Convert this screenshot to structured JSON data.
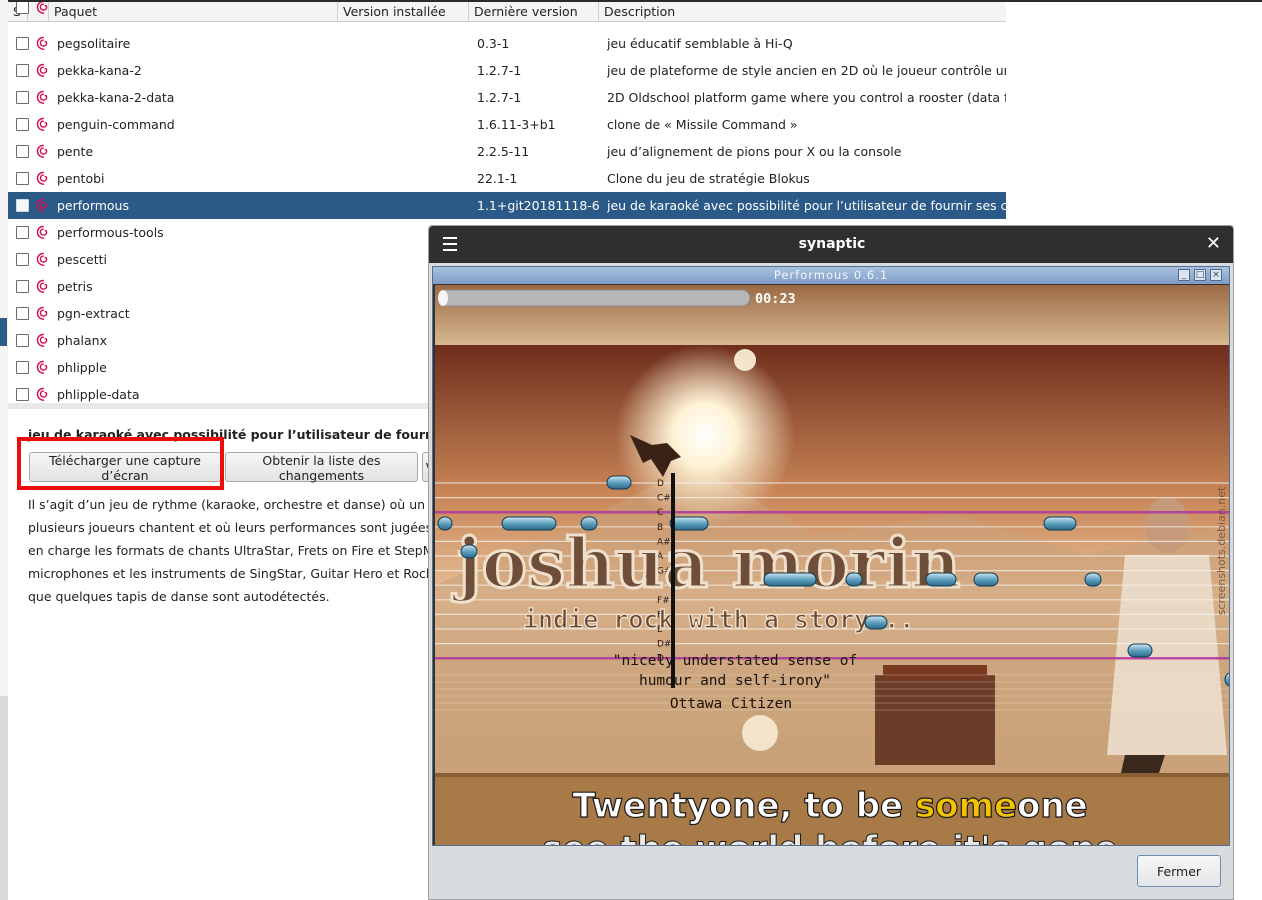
{
  "table": {
    "columns": [
      "S",
      "",
      "Paquet",
      "Version installée",
      "Dernière version",
      "Description"
    ],
    "rows": [
      {
        "name": "pegsolitaire",
        "version": "0.3-1",
        "description": "jeu éducatif semblable à Hi-Q"
      },
      {
        "name": "pekka-kana-2",
        "version": "1.2.7-1",
        "description": "jeu de plateforme de style ancien en 2D où le joueur contrôle un coq"
      },
      {
        "name": "pekka-kana-2-data",
        "version": "1.2.7-1",
        "description": "2D Oldschool platform game where you control a rooster (data file)"
      },
      {
        "name": "penguin-command",
        "version": "1.6.11-3+b1",
        "description": "clone de « Missile Command »"
      },
      {
        "name": "pente",
        "version": "2.2.5-11",
        "description": "jeu d’alignement de pions pour X ou la console"
      },
      {
        "name": "pentobi",
        "version": "22.1-1",
        "description": "Clone du jeu de stratégie Blokus"
      },
      {
        "name": "performous",
        "version": "1.1+git20181118-6",
        "description": "jeu de karaoké avec possibilité pour l’utilisateur de fournir ses chansons"
      },
      {
        "name": "performous-tools",
        "version": "",
        "description": ""
      },
      {
        "name": "pescetti",
        "version": "",
        "description": ""
      },
      {
        "name": "petris",
        "version": "",
        "description": ""
      },
      {
        "name": "pgn-extract",
        "version": "",
        "description": ""
      },
      {
        "name": "phalanx",
        "version": "",
        "description": ""
      },
      {
        "name": "phlipple",
        "version": "",
        "description": ""
      },
      {
        "name": "phlipple-data",
        "version": "",
        "description": ""
      }
    ],
    "selected_index": 6
  },
  "details": {
    "title": "jeu de karaoké avec possibilité pour l’utilisateur de fournir ses",
    "screenshot_button": "Télécharger une capture d’écran",
    "changelog_button": "Obtenir la liste des changements",
    "extra_button": "V",
    "description_lines": [
      "Il s’agit d’un jeu de rythme (karaoke, orchestre et danse) où un ou",
      " plusieurs joueurs chantent et où leurs performances sont jugées. Il prend",
      "en charge les formats de chants UltraStar, Frets on Fire et StepMania. Les",
      "microphones et les instruments de SingStar, Guitar Hero et Rock Band, ainsi",
      "que quelques tapis de danse sont autodétectés."
    ]
  },
  "dialog": {
    "title": "synaptic",
    "close_button": "Fermer",
    "inner_window": {
      "title": "Performous 0.6.1",
      "time": "00:23",
      "progress": 0.03,
      "poster_title": "joshua morin",
      "poster_subtitle": "indie rock with a story...",
      "quote_line1": "\"nicely understated sense of",
      "quote_line2": "humour and self-irony\"",
      "quote_source": "Ottawa Citizen",
      "watermark": "screenshots.debian.net",
      "note_labels": [
        "D",
        "C#",
        "C",
        "B",
        "A#",
        "A",
        "G#",
        "G",
        "F#",
        "F",
        "E",
        "D#",
        "D"
      ],
      "lyric_before": "Twentyone, to be ",
      "lyric_highlight": "some",
      "lyric_after": "one",
      "lyric_next": "see the world before it's gone"
    }
  },
  "colors": {
    "selection": "#2b5a88",
    "highlight_box": "#ee0c0c",
    "lyric_highlight": "#f2c300",
    "debian_swirl": "#d70751"
  }
}
